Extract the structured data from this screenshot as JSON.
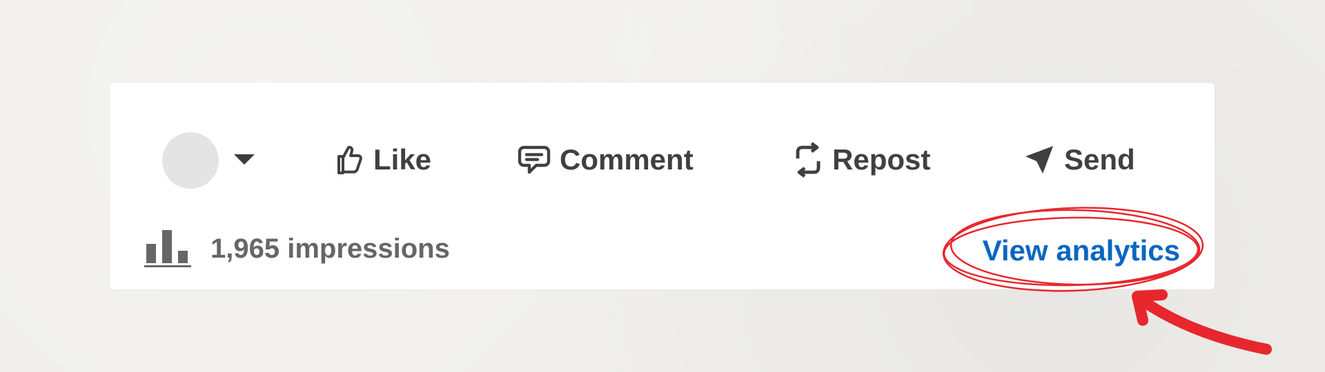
{
  "post_actions": {
    "like_label": "Like",
    "comment_label": "Comment",
    "repost_label": "Repost",
    "send_label": "Send"
  },
  "stats": {
    "impressions_text": "1,965 impressions",
    "view_analytics_label": "View analytics"
  },
  "icons": {
    "reaction_avatar": "avatar-placeholder",
    "reaction_selector": "caret-down-icon",
    "like": "thumbs-up-icon",
    "comment": "speech-bubble-icon",
    "repost": "repost-arrows-icon",
    "send": "paper-plane-icon",
    "impressions": "bar-chart-icon"
  },
  "colors": {
    "link_blue": "#0a66c2",
    "action_text": "#404040",
    "stat_text": "#666666",
    "annotation_red": "#e8262d",
    "background": "#efeeeb",
    "card": "#ffffff"
  }
}
